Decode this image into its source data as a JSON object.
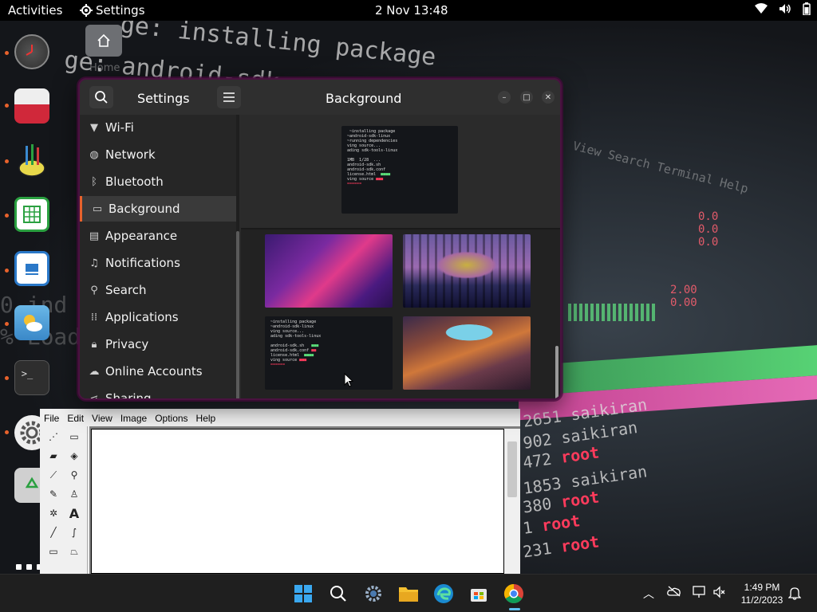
{
  "topbar": {
    "activities": "Activities",
    "app_name": "Settings",
    "clock": "2 Nov  13:48"
  },
  "desktop": {
    "home_label": "Home",
    "wallpaper_text": {
      "line1": "ge: installing package",
      "line2": "ge: android-sdk",
      "term_menu": "View   Search   Terminal   Help",
      "procs": [
        {
          "pid": "2651",
          "user": "saikiran"
        },
        {
          "pid": "902",
          "user": "saikiran"
        },
        {
          "pid": "472",
          "user": "root"
        },
        {
          "pid": "1853",
          "user": "saikiran"
        },
        {
          "pid": "380",
          "user": "root"
        },
        {
          "pid": "1",
          "user": "root"
        },
        {
          "pid": "231",
          "user": "root"
        }
      ]
    }
  },
  "dock": {
    "apps": [
      "clock-app",
      "screenshot-app",
      "paint-app",
      "spreadsheet-app",
      "writer-app",
      "weather-app",
      "terminal-app",
      "settings-app",
      "trash-app"
    ]
  },
  "settings_window": {
    "title": "Settings",
    "page_title": "Background",
    "sidebar": [
      {
        "label": "Wi-Fi",
        "icon": "wifi-icon"
      },
      {
        "label": "Network",
        "icon": "network-icon"
      },
      {
        "label": "Bluetooth",
        "icon": "bluetooth-icon"
      },
      {
        "label": "Background",
        "icon": "display-icon",
        "active": true
      },
      {
        "label": "Appearance",
        "icon": "appearance-icon"
      },
      {
        "label": "Notifications",
        "icon": "bell-icon"
      },
      {
        "label": "Search",
        "icon": "search-icon"
      },
      {
        "label": "Applications",
        "icon": "apps-grid-icon"
      },
      {
        "label": "Privacy",
        "icon": "lock-icon"
      },
      {
        "label": "Online Accounts",
        "icon": "cloud-icon"
      },
      {
        "label": "Sharing",
        "icon": "share-icon"
      }
    ],
    "wallpapers": [
      "terminal",
      "galaxy",
      "sphere",
      "terminal",
      "canyon"
    ]
  },
  "paint_window": {
    "menu": [
      "File",
      "Edit",
      "View",
      "Image",
      "Options",
      "Help"
    ]
  },
  "taskbar": {
    "time": "1:49 PM",
    "date": "11/2/2023"
  },
  "colors": {
    "accent": "#e8622c",
    "window_border": "#4a1240",
    "taskbar_active": "#5cc0f0"
  }
}
